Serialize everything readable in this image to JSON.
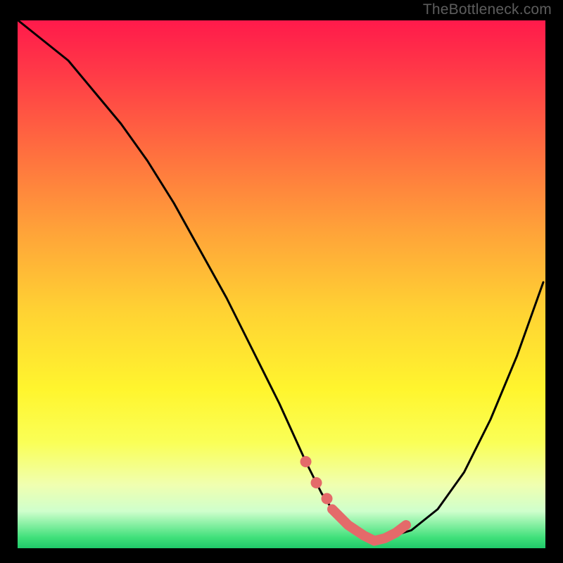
{
  "watermark": "TheBottleneck.com",
  "chart_data": {
    "type": "line",
    "title": "",
    "xlabel": "",
    "ylabel": "",
    "xlim": [
      0,
      100
    ],
    "ylim": [
      0,
      100
    ],
    "grid": false,
    "series": [
      {
        "name": "curve",
        "color": "#000000",
        "x": [
          0,
          5,
          10,
          15,
          20,
          25,
          30,
          35,
          40,
          45,
          50,
          55,
          58,
          60,
          63,
          66,
          68,
          70,
          75,
          80,
          85,
          90,
          95,
          100
        ],
        "y": [
          100,
          96,
          92,
          86,
          80,
          73,
          65,
          56,
          47,
          37,
          27,
          16,
          10,
          7,
          4,
          2,
          1,
          1.5,
          3,
          7,
          14,
          24,
          36,
          50
        ]
      },
      {
        "name": "highlight",
        "color": "#e46a6a",
        "x": [
          55,
          57,
          59,
          60,
          63,
          66,
          68,
          70,
          72,
          74
        ],
        "y": [
          16,
          12,
          9,
          7,
          4,
          2,
          1,
          1.5,
          2.5,
          4
        ]
      }
    ]
  }
}
